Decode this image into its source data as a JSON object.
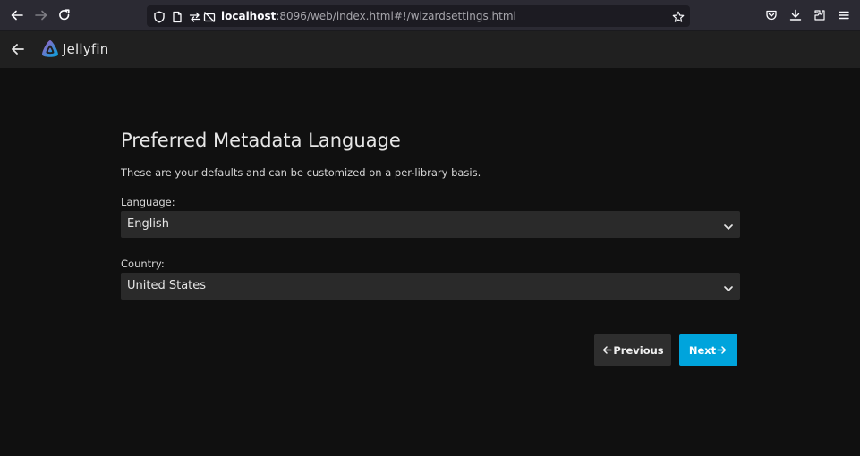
{
  "browser": {
    "url_host": "localhost",
    "url_rest": ":8096/web/index.html#!/wizardsettings.html",
    "icons": {
      "back": "back-arrow-icon",
      "forward": "forward-arrow-icon",
      "reload": "reload-icon",
      "shield": "tracking-shield-icon",
      "page": "page-info-icon",
      "permissions": "permissions-icon",
      "camera_blocked": "camera-blocked-icon",
      "bookmark": "star-icon",
      "pocket": "pocket-icon",
      "downloads": "download-icon",
      "extensions": "extensions-icon",
      "menu": "hamburger-menu-icon"
    }
  },
  "app": {
    "brand": "Jellyfin",
    "accent_color": "#00a4dc"
  },
  "wizard": {
    "title": "Preferred Metadata Language",
    "subtitle": "These are your defaults and can be customized on a per-library basis.",
    "language_label": "Language:",
    "language_value": "English",
    "country_label": "Country:",
    "country_value": "United States",
    "previous_label": "Previous",
    "next_label": "Next"
  }
}
